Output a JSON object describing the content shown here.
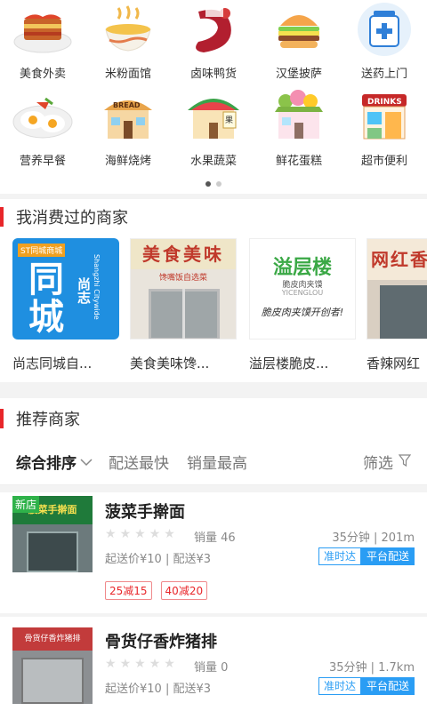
{
  "categories": [
    {
      "label": "美食外卖",
      "icon": "lasagna-icon"
    },
    {
      "label": "米粉面馆",
      "icon": "noodle-bowl-icon"
    },
    {
      "label": "卤味鸭货",
      "icon": "duck-neck-icon"
    },
    {
      "label": "汉堡披萨",
      "icon": "burger-icon"
    },
    {
      "label": "送药上门",
      "icon": "medicine-jar-icon"
    },
    {
      "label": "营养早餐",
      "icon": "fried-eggs-icon"
    },
    {
      "label": "海鲜烧烤",
      "icon": "bread-house-icon"
    },
    {
      "label": "水果蔬菜",
      "icon": "fruit-house-icon"
    },
    {
      "label": "鲜花蛋糕",
      "icon": "flower-house-icon"
    },
    {
      "label": "超市便利",
      "icon": "drinks-store-icon"
    }
  ],
  "pager": {
    "total": 2,
    "active": 0
  },
  "visited": {
    "title": "我消费过的商家",
    "items": [
      {
        "name": "尚志同城自...",
        "logo_main": "同城",
        "logo_side": "尚志",
        "logo_tag": "ST同城商城",
        "logo_en": "Shangzhi Citywide"
      },
      {
        "name": "美食美味馋...",
        "sign": "美食美味",
        "sign_sub": "馋嘴饭自选菜"
      },
      {
        "name": "溢层楼脆皮...",
        "logo": "溢层楼",
        "logo_sub": "脆皮肉夹馍",
        "logo_en": "YICENGLOU",
        "slogan": "脆皮肉夹馍开创者!"
      },
      {
        "name": "香辣网红",
        "sign": "网红香辣"
      }
    ]
  },
  "recommend": {
    "title": "推荐商家",
    "sort": {
      "default": "综合排序",
      "fastest": "配送最快",
      "sales": "销量最高",
      "filter": "筛选"
    },
    "shops": [
      {
        "name": "菠菜手擀面",
        "sales": "销量 46",
        "meta": "35分钟 | 201m",
        "price": "起送价¥10 | 配送¥3",
        "tag1": "准时达",
        "tag2": "平台配送",
        "promos": [
          "25减15",
          "40减20"
        ],
        "badge": "新店",
        "sign": "菠菜手擀面"
      },
      {
        "name": "骨货仔香炸猪排",
        "sales": "销量 0",
        "meta": "35分钟 | 1.7km",
        "price": "起送价¥10 | 配送¥3",
        "tag1": "准时达",
        "tag2": "平台配送",
        "sign": "骨货仔香炸猪排"
      }
    ]
  },
  "colors": {
    "accent_red": "#e8262a",
    "tag_blue": "#2a9df4",
    "badge_green": "#2fb24a"
  }
}
